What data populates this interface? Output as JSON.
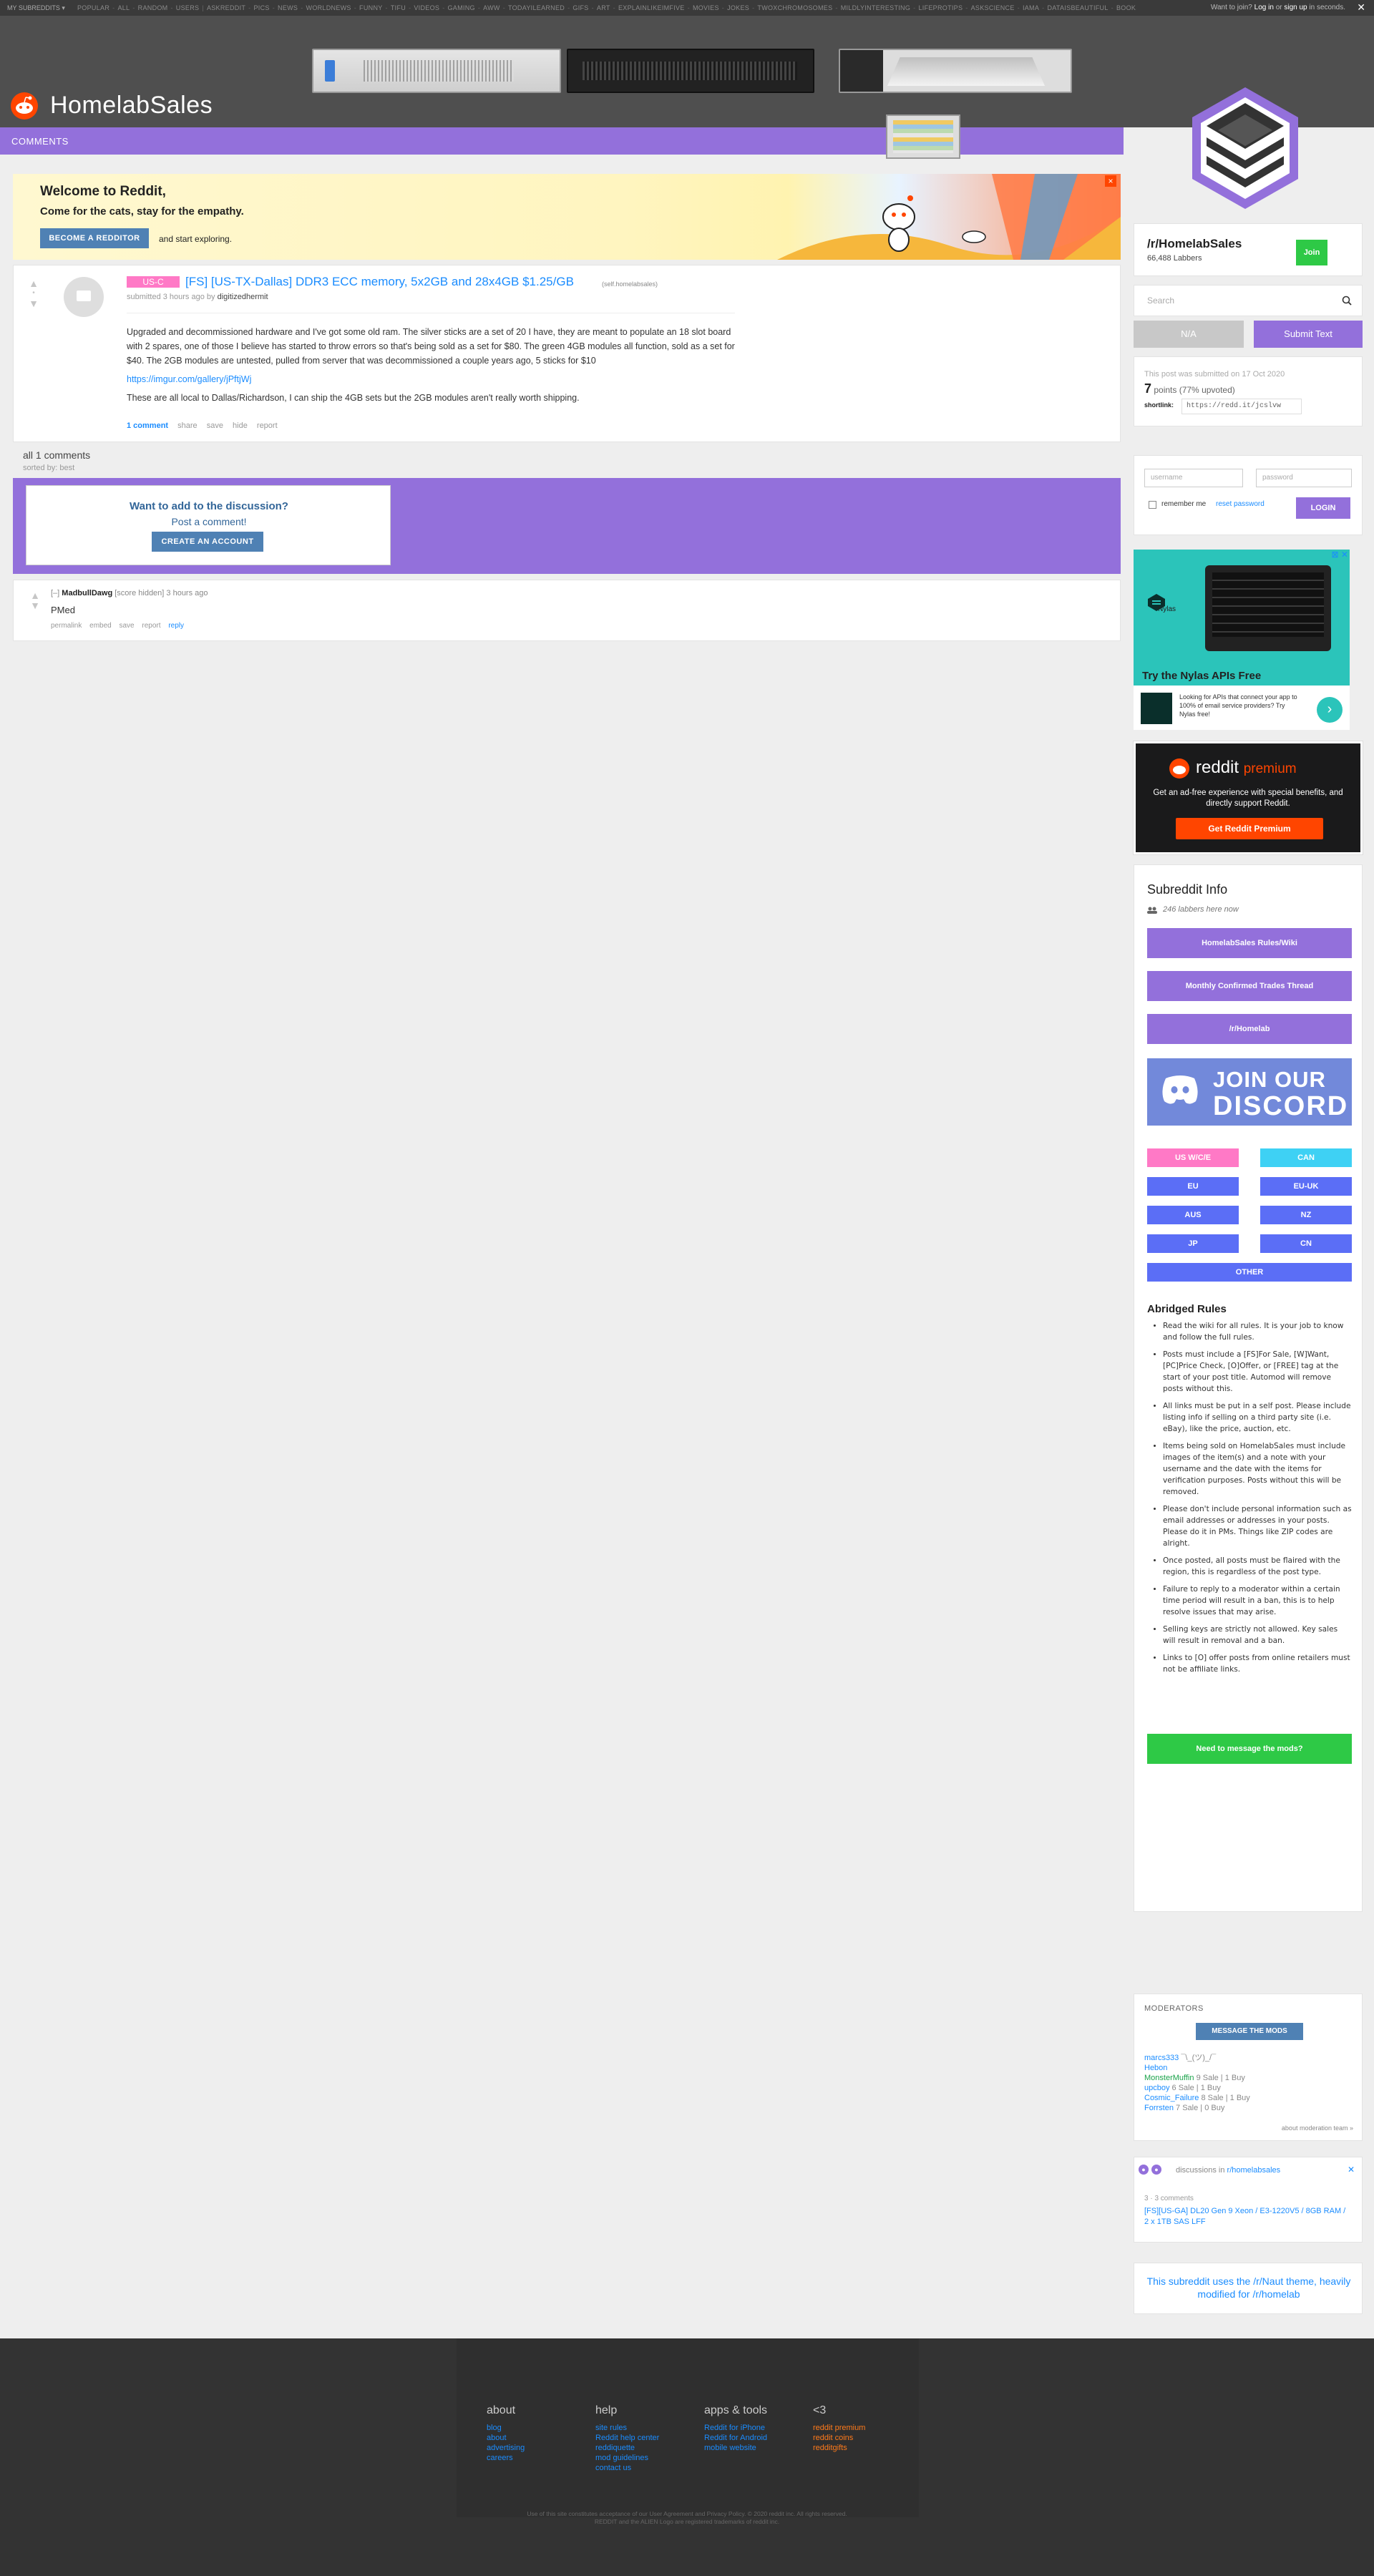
{
  "topbar": {
    "my_subreddits": "MY SUBREDDITS ▾",
    "subreddits": [
      "POPULAR",
      "ALL",
      "RANDOM",
      "USERS",
      "ASKREDDIT",
      "PICS",
      "NEWS",
      "WORLDNEWS",
      "FUNNY",
      "TIFU",
      "VIDEOS",
      "GAMING",
      "AWW",
      "TODAYILEARNED",
      "GIFS",
      "ART",
      "EXPLAINLIKEIMFIVE",
      "MOVIES",
      "JOKES",
      "TWOXCHROMOSOMES",
      "MILDLYINTERESTING",
      "LIFEPROTIPS",
      "ASKSCIENCE",
      "IAMA",
      "DATAISBEAUTIFUL",
      "BOOKS",
      "SCIENCE"
    ],
    "more": "MORE »",
    "want_to_join": "Want to join?",
    "login": "Log in",
    "or": "or",
    "signup": "sign up",
    "in_seconds": "in seconds.",
    "close": "✕"
  },
  "header": {
    "site_name": "HomelabSales",
    "tab": "COMMENTS"
  },
  "welcome": {
    "title": "Welcome to Reddit,",
    "subtitle": "Come for the cats, stay for the empathy.",
    "button": "BECOME A REDDITOR",
    "explore": "and start exploring.",
    "close": "×"
  },
  "post": {
    "flair": "US-C",
    "title": "[FS] [US-TX-Dallas] DDR3 ECC memory, 5x2GB and 28x4GB $1.25/GB",
    "domain": "(self.homelabsales)",
    "submitted": "submitted 3 hours ago by",
    "author": "digitizedhermit",
    "score": "•",
    "body": [
      "Upgraded and decommissioned hardware and I've got some old ram. The silver sticks are a set of 20 I have, they are meant to populate an 18 slot board with 2 spares, one of those I believe has started to throw errors so that's being sold as a set for $80. The green 4GB modules all function, sold as a set for $40. The 2GB modules are untested, pulled from server that was decommissioned a couple years ago, 5 sticks for $10",
      "https://imgur.com/gallery/jPftjWj",
      "These are all local to Dallas/Richardson, I can ship the 4GB sets but the 2GB modules aren't really worth shipping."
    ],
    "buttons": {
      "comments": "1 comment",
      "share": "share",
      "save": "save",
      "hide": "hide",
      "report": "report"
    }
  },
  "comments_header": {
    "all": "all 1 comments",
    "sorted": "sorted by: best"
  },
  "discuss": {
    "question": "Want to add to the discussion?",
    "post": "Post a comment!",
    "button": "CREATE AN ACCOUNT"
  },
  "comment": {
    "collapse": "[–]",
    "author": "MadbullDawg",
    "meta": "[score hidden] 3 hours ago",
    "text": "PMed",
    "buttons": {
      "permalink": "permalink",
      "embed": "embed",
      "save": "save",
      "report": "report",
      "reply": "reply"
    }
  },
  "sidebar": {
    "subreddit": "/r/HomelabSales",
    "subscribers": "66,488 Labbers",
    "join": "Join",
    "search_placeholder": "Search",
    "na": "N/A",
    "submit_text": "Submit Text",
    "submitted_on": "This post was submitted on 17 Oct 2020",
    "points": "7",
    "points_label": "points (77% upvoted)",
    "shortlink_label": "shortlink:",
    "shortlink": "https://redd.it/jcslvw",
    "username_placeholder": "username",
    "password_placeholder": "password",
    "remember_me": "remember me",
    "reset_password": "reset password",
    "login": "LOGIN"
  },
  "ad": {
    "close": "⊠ ✕",
    "brand": "Nylas",
    "title": "Try the Nylas APIs Free",
    "text": "Looking for APIs that connect your app to 100% of email service providers? Try Nylas free!",
    "arrow": "›"
  },
  "premium": {
    "reddit": "reddit",
    "premium": "premium",
    "text": "Get an ad-free experience with special benefits, and directly support Reddit.",
    "button": "Get Reddit Premium"
  },
  "info": {
    "heading": "Subreddit Info",
    "online": "246 labbers here now",
    "buttons": [
      "HomelabSales Rules/Wiki",
      "Monthly Confirmed Trades Thread",
      "/r/Homelab"
    ],
    "discord_line1": "JOIN OUR",
    "discord_line2": "DISCORD",
    "regions": [
      "US W/C/E",
      "CAN",
      "EU",
      "EU-UK",
      "AUS",
      "NZ",
      "JP",
      "CN",
      "OTHER"
    ],
    "abridged": "Abridged Rules",
    "rules": [
      "Read the wiki for all rules. It is your job to know and follow the full rules.",
      "Posts must include a [FS]For Sale, [W]Want, [PC]Price Check, [O]Offer, or [FREE] tag at the start of your post title. Automod will remove posts without this.",
      "All links must be put in a self post. Please include listing info if selling on a third party site (i.e. eBay), like the price, auction, etc.",
      "Items being sold on HomelabSales must include images of the item(s) and a note with your username and the date with the items for verification purposes. Posts without this will be removed.",
      "Please don't include personal information such as email addresses or addresses in your posts. Please do it in PMs. Things like ZIP codes are alright.",
      "Once posted, all posts must be flaired with the region, this is regardless of the post type.",
      "Failure to reply to a moderator within a certain time period will result in a ban, this is to help resolve issues that may arise.",
      "Selling keys are strictly not allowed. Key sales will result in removal and a ban.",
      "Links to [O] offer posts from online retailers must not be affiliate links."
    ],
    "message_mods": "Need to message the mods?"
  },
  "moderators": {
    "heading": "MODERATORS",
    "button": "MESSAGE THE MODS",
    "list": [
      {
        "name": "marcs333",
        "flair": "¯\\_(ツ)_/¯"
      },
      {
        "name": "Hebon",
        "flair": ""
      },
      {
        "name": "MonsterMuffin",
        "flair": "9 Sale | 1 Buy"
      },
      {
        "name": "upcboy",
        "flair": "6 Sale | 1 Buy"
      },
      {
        "name": "Cosmic_Failure",
        "flair": "8 Sale | 1 Buy"
      },
      {
        "name": "Forrsten",
        "flair": "7 Sale | 0 Buy"
      }
    ],
    "more": "about moderation team »"
  },
  "discussions": {
    "heading": "discussions in",
    "sub": "r/homelabsales",
    "close": "✕",
    "count": "3 · 3 comments",
    "link": "[FS][US-GA] DL20 Gen 9 Xeon / E3-1220V5 / 8GB RAM / 2 x 1TB SAS LFF"
  },
  "theme": {
    "text": "This subreddit uses the /r/Naut theme, heavily modified for /r/homelab"
  },
  "footer": {
    "about": {
      "h": "about",
      "items": [
        "blog",
        "about",
        "advertising",
        "careers"
      ]
    },
    "help": {
      "h": "help",
      "items": [
        "site rules",
        "Reddit help center",
        "reddiquette",
        "mod guidelines",
        "contact us"
      ]
    },
    "apps": {
      "h": "apps & tools",
      "items": [
        "Reddit for iPhone",
        "Reddit for Android",
        "mobile website"
      ]
    },
    "love": {
      "h": "<3",
      "items": [
        "reddit premium",
        "reddit coins",
        "redditgifts"
      ]
    },
    "legal1": "Use of this site constitutes acceptance of our User Agreement and Privacy Policy. © 2020 reddit inc. All rights reserved.",
    "legal2": "REDDIT and the ALIEN Logo are registered trademarks of reddit inc."
  },
  "colors": {
    "accent": "#9370db",
    "link": "#1a8cff",
    "join_green": "#2ec946",
    "orange": "#ff4500",
    "header_bg": "#4f4f4f"
  }
}
